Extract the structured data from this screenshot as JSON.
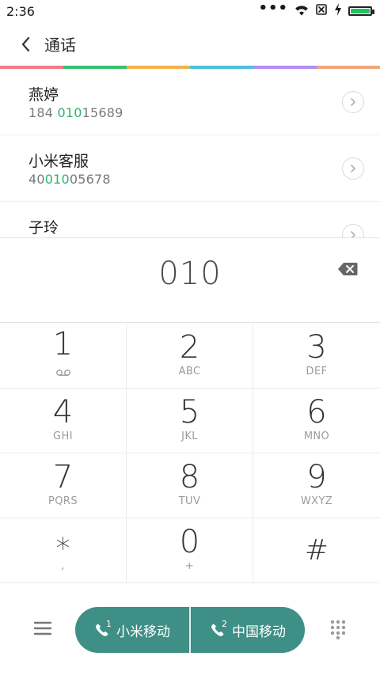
{
  "status": {
    "time": "2:36",
    "battery_percent": 100
  },
  "header": {
    "title": "通话"
  },
  "rainbow_colors": [
    "#f07b8b",
    "#38c06f",
    "#f2b24e",
    "#4bc2d8",
    "#b48df2",
    "#f0a77a"
  ],
  "results": [
    {
      "name": "燕婷",
      "number_prefix": "184 ",
      "number_match": "010",
      "number_suffix": "15689"
    },
    {
      "name": "小米客服",
      "number_prefix": "40",
      "number_match": "010",
      "number_suffix": "05678"
    },
    {
      "name": "子玲",
      "number_prefix": "",
      "number_match": "",
      "number_suffix": ""
    }
  ],
  "dialer": {
    "input_value": "010"
  },
  "keypad": [
    {
      "digit": "1",
      "letters": ""
    },
    {
      "digit": "2",
      "letters": "ABC"
    },
    {
      "digit": "3",
      "letters": "DEF"
    },
    {
      "digit": "4",
      "letters": "GHI"
    },
    {
      "digit": "5",
      "letters": "JKL"
    },
    {
      "digit": "6",
      "letters": "MNO"
    },
    {
      "digit": "7",
      "letters": "PQRS"
    },
    {
      "digit": "8",
      "letters": "TUV"
    },
    {
      "digit": "9",
      "letters": "WXYZ"
    },
    {
      "digit": "∗",
      "letters": ","
    },
    {
      "digit": "0",
      "letters": "+"
    },
    {
      "digit": "#",
      "letters": ""
    }
  ],
  "call_buttons": [
    {
      "label": "小米移动",
      "sim": "1"
    },
    {
      "label": "中国移动",
      "sim": "2"
    }
  ],
  "colors": {
    "match_green": "#2db36b",
    "call_teal": "#3e8f86",
    "battery_green": "#21c25e"
  }
}
